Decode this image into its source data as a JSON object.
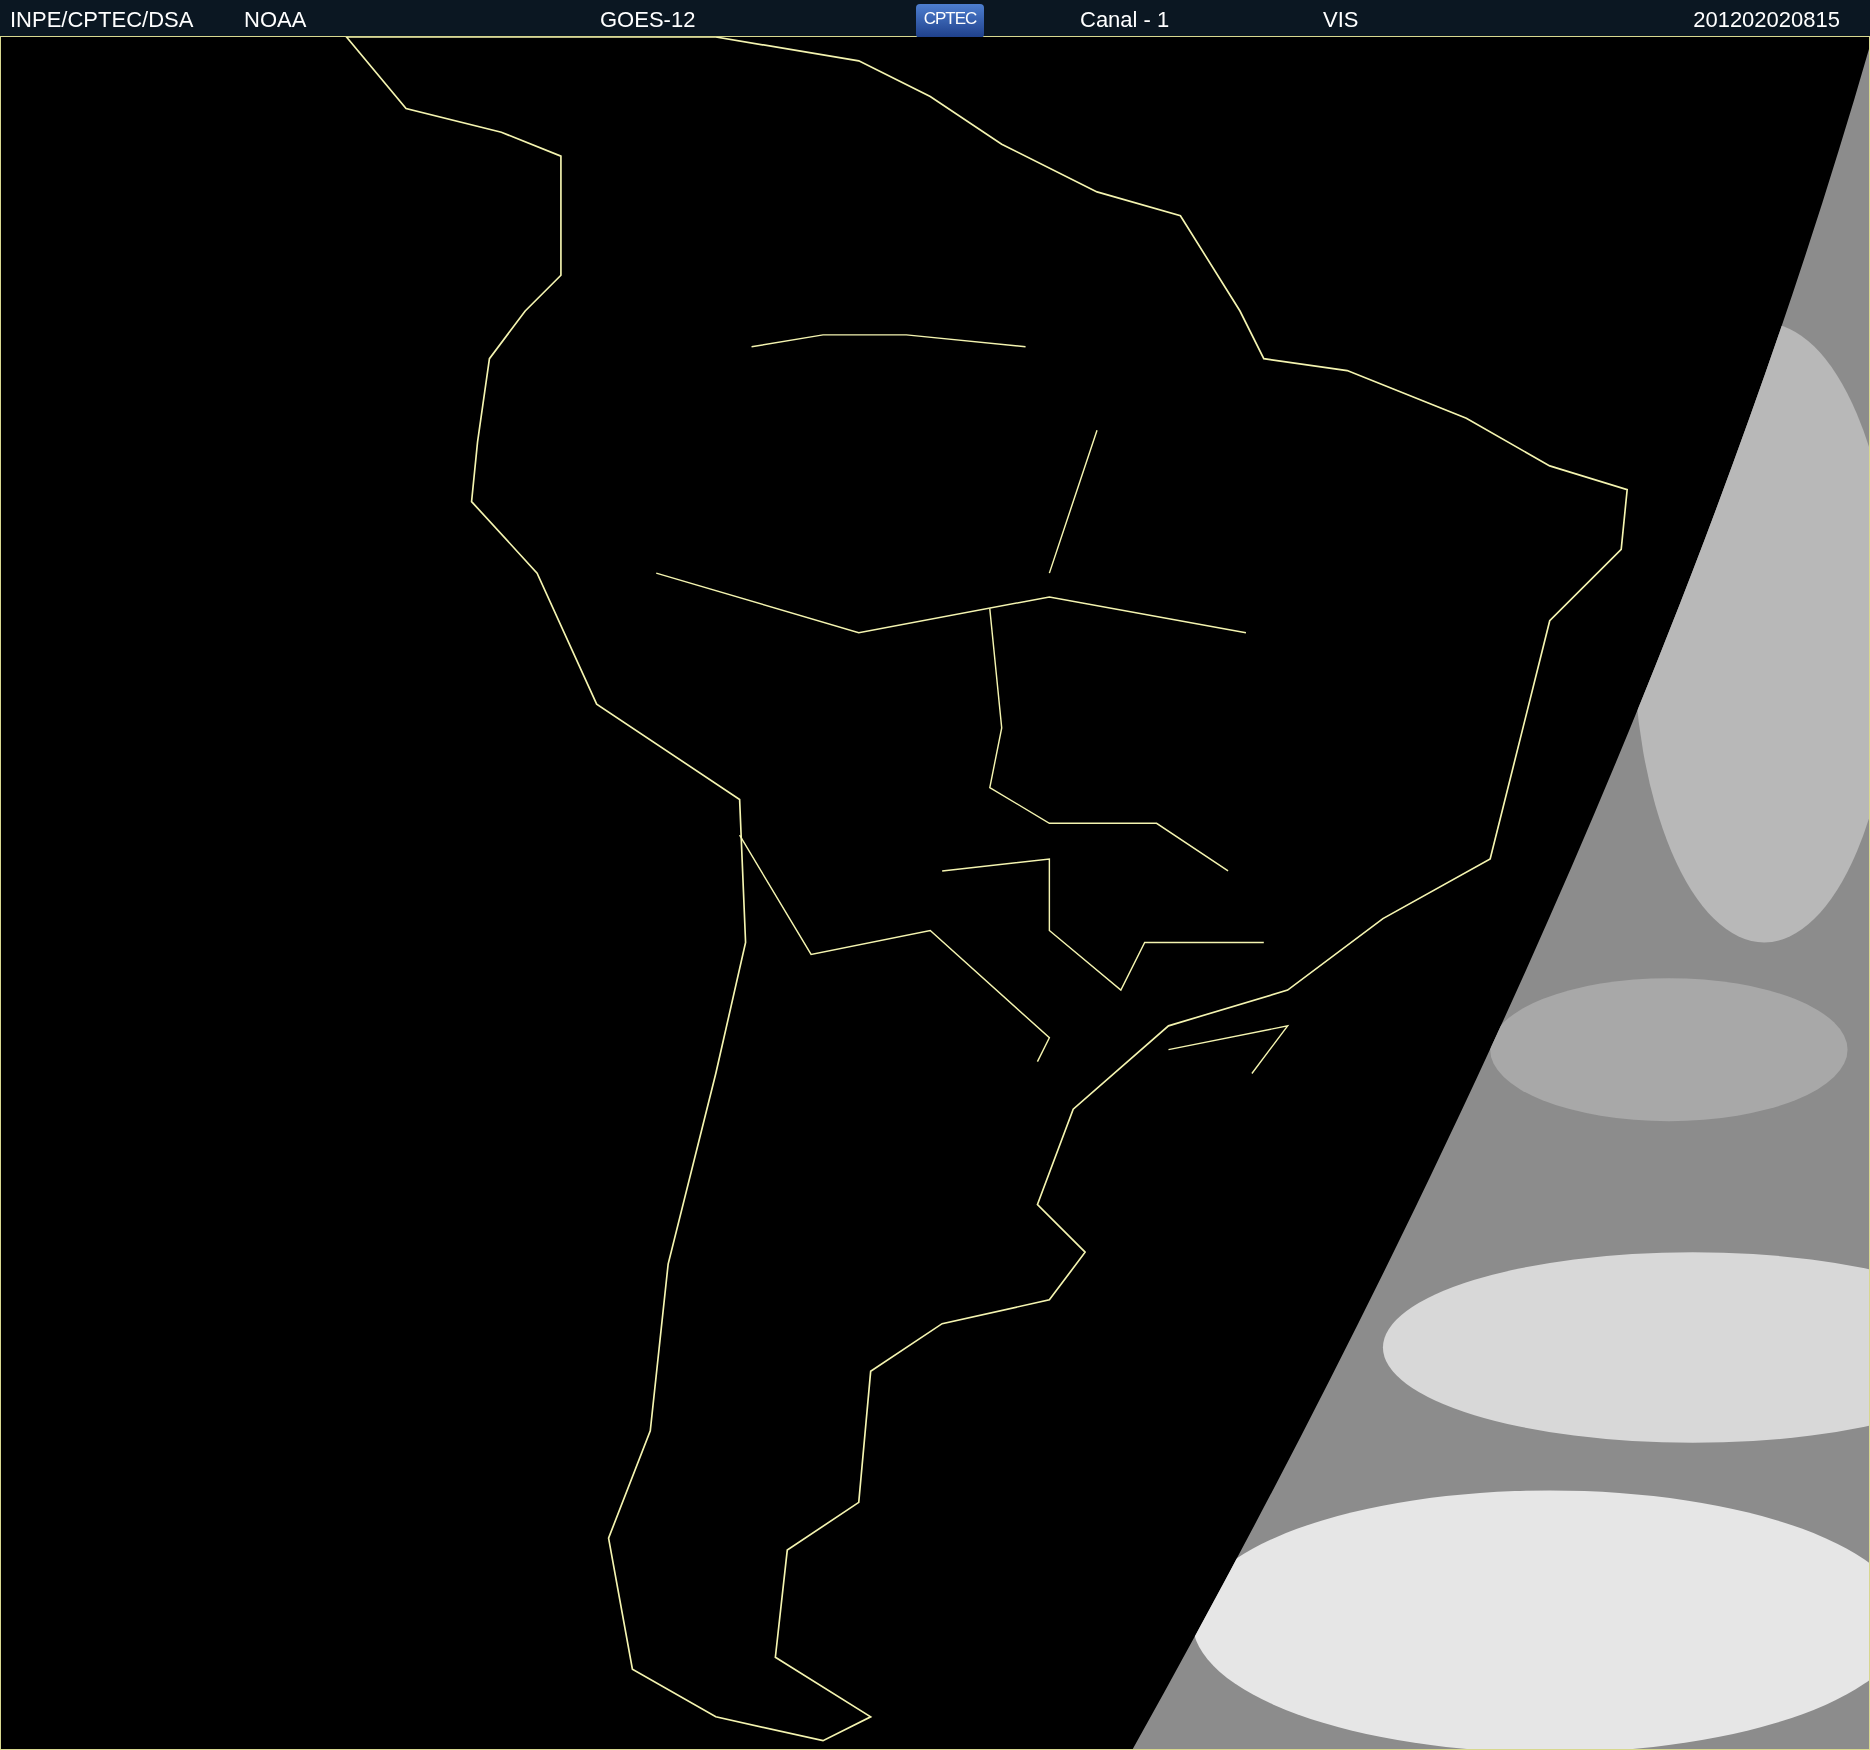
{
  "header": {
    "items": [
      {
        "text": "INPE/CPTEC/DSA"
      },
      {
        "text": "NOAA"
      },
      {
        "text": "GOES-12"
      },
      {
        "text": "CPTEC",
        "kind": "logo"
      },
      {
        "text": "Canal - 1"
      },
      {
        "text": "VIS"
      },
      {
        "text": "201202020815"
      }
    ]
  }
}
